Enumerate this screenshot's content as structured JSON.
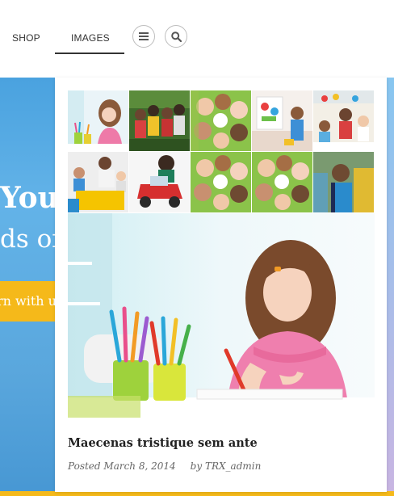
{
  "nav": {
    "items": [
      {
        "label": "SHOP"
      },
      {
        "label": "IMAGES",
        "active": true
      }
    ],
    "menu_icon": "menu-icon",
    "search_icon": "search-icon"
  },
  "hero": {
    "heading": "You",
    "subheading": "ds of",
    "cta_label": "rn with u"
  },
  "gallery": {
    "thumbnails": [
      {
        "subject": "girl drawing with pencils"
      },
      {
        "subject": "group of kids outdoors"
      },
      {
        "subject": "kids faces in a circle"
      },
      {
        "subject": "boy painting at easel"
      },
      {
        "subject": "kids in classroom"
      },
      {
        "subject": "kids at yellow table with teacher"
      },
      {
        "subject": "child in toy car"
      },
      {
        "subject": "kids faces in a circle"
      },
      {
        "subject": "kids faces in a circle"
      },
      {
        "subject": "smiling boy with backpack"
      }
    ],
    "feature_subject": "girl drawing with pencils"
  },
  "post": {
    "title": "Maecenas tristique sem ante",
    "posted_label": "Posted",
    "date": "March 8, 2014",
    "by_label": "by",
    "author": "TRX_admin"
  },
  "colors": {
    "accent_yellow": "#f5b91a",
    "hero_blue": "#5aa7dd",
    "text_dark": "#222222"
  }
}
